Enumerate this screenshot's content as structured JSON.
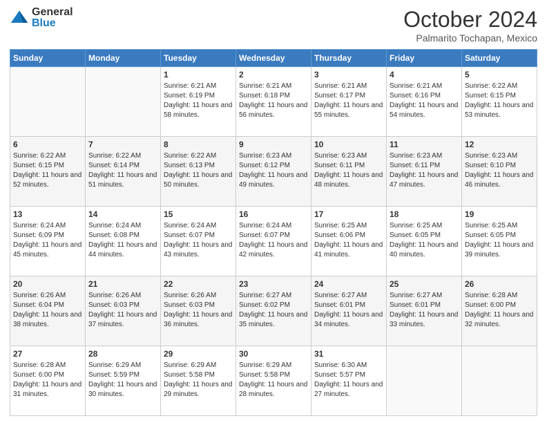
{
  "header": {
    "logo_general": "General",
    "logo_blue": "Blue",
    "month": "October 2024",
    "location": "Palmarito Tochapan, Mexico"
  },
  "days_of_week": [
    "Sunday",
    "Monday",
    "Tuesday",
    "Wednesday",
    "Thursday",
    "Friday",
    "Saturday"
  ],
  "weeks": [
    [
      {
        "day": "",
        "info": ""
      },
      {
        "day": "",
        "info": ""
      },
      {
        "day": "1",
        "info": "Sunrise: 6:21 AM\nSunset: 6:19 PM\nDaylight: 11 hours and 58 minutes."
      },
      {
        "day": "2",
        "info": "Sunrise: 6:21 AM\nSunset: 6:18 PM\nDaylight: 11 hours and 56 minutes."
      },
      {
        "day": "3",
        "info": "Sunrise: 6:21 AM\nSunset: 6:17 PM\nDaylight: 11 hours and 55 minutes."
      },
      {
        "day": "4",
        "info": "Sunrise: 6:21 AM\nSunset: 6:16 PM\nDaylight: 11 hours and 54 minutes."
      },
      {
        "day": "5",
        "info": "Sunrise: 6:22 AM\nSunset: 6:15 PM\nDaylight: 11 hours and 53 minutes."
      }
    ],
    [
      {
        "day": "6",
        "info": "Sunrise: 6:22 AM\nSunset: 6:15 PM\nDaylight: 11 hours and 52 minutes."
      },
      {
        "day": "7",
        "info": "Sunrise: 6:22 AM\nSunset: 6:14 PM\nDaylight: 11 hours and 51 minutes."
      },
      {
        "day": "8",
        "info": "Sunrise: 6:22 AM\nSunset: 6:13 PM\nDaylight: 11 hours and 50 minutes."
      },
      {
        "day": "9",
        "info": "Sunrise: 6:23 AM\nSunset: 6:12 PM\nDaylight: 11 hours and 49 minutes."
      },
      {
        "day": "10",
        "info": "Sunrise: 6:23 AM\nSunset: 6:11 PM\nDaylight: 11 hours and 48 minutes."
      },
      {
        "day": "11",
        "info": "Sunrise: 6:23 AM\nSunset: 6:11 PM\nDaylight: 11 hours and 47 minutes."
      },
      {
        "day": "12",
        "info": "Sunrise: 6:23 AM\nSunset: 6:10 PM\nDaylight: 11 hours and 46 minutes."
      }
    ],
    [
      {
        "day": "13",
        "info": "Sunrise: 6:24 AM\nSunset: 6:09 PM\nDaylight: 11 hours and 45 minutes."
      },
      {
        "day": "14",
        "info": "Sunrise: 6:24 AM\nSunset: 6:08 PM\nDaylight: 11 hours and 44 minutes."
      },
      {
        "day": "15",
        "info": "Sunrise: 6:24 AM\nSunset: 6:07 PM\nDaylight: 11 hours and 43 minutes."
      },
      {
        "day": "16",
        "info": "Sunrise: 6:24 AM\nSunset: 6:07 PM\nDaylight: 11 hours and 42 minutes."
      },
      {
        "day": "17",
        "info": "Sunrise: 6:25 AM\nSunset: 6:06 PM\nDaylight: 11 hours and 41 minutes."
      },
      {
        "day": "18",
        "info": "Sunrise: 6:25 AM\nSunset: 6:05 PM\nDaylight: 11 hours and 40 minutes."
      },
      {
        "day": "19",
        "info": "Sunrise: 6:25 AM\nSunset: 6:05 PM\nDaylight: 11 hours and 39 minutes."
      }
    ],
    [
      {
        "day": "20",
        "info": "Sunrise: 6:26 AM\nSunset: 6:04 PM\nDaylight: 11 hours and 38 minutes."
      },
      {
        "day": "21",
        "info": "Sunrise: 6:26 AM\nSunset: 6:03 PM\nDaylight: 11 hours and 37 minutes."
      },
      {
        "day": "22",
        "info": "Sunrise: 6:26 AM\nSunset: 6:03 PM\nDaylight: 11 hours and 36 minutes."
      },
      {
        "day": "23",
        "info": "Sunrise: 6:27 AM\nSunset: 6:02 PM\nDaylight: 11 hours and 35 minutes."
      },
      {
        "day": "24",
        "info": "Sunrise: 6:27 AM\nSunset: 6:01 PM\nDaylight: 11 hours and 34 minutes."
      },
      {
        "day": "25",
        "info": "Sunrise: 6:27 AM\nSunset: 6:01 PM\nDaylight: 11 hours and 33 minutes."
      },
      {
        "day": "26",
        "info": "Sunrise: 6:28 AM\nSunset: 6:00 PM\nDaylight: 11 hours and 32 minutes."
      }
    ],
    [
      {
        "day": "27",
        "info": "Sunrise: 6:28 AM\nSunset: 6:00 PM\nDaylight: 11 hours and 31 minutes."
      },
      {
        "day": "28",
        "info": "Sunrise: 6:29 AM\nSunset: 5:59 PM\nDaylight: 11 hours and 30 minutes."
      },
      {
        "day": "29",
        "info": "Sunrise: 6:29 AM\nSunset: 5:58 PM\nDaylight: 11 hours and 29 minutes."
      },
      {
        "day": "30",
        "info": "Sunrise: 6:29 AM\nSunset: 5:58 PM\nDaylight: 11 hours and 28 minutes."
      },
      {
        "day": "31",
        "info": "Sunrise: 6:30 AM\nSunset: 5:57 PM\nDaylight: 11 hours and 27 minutes."
      },
      {
        "day": "",
        "info": ""
      },
      {
        "day": "",
        "info": ""
      }
    ]
  ]
}
